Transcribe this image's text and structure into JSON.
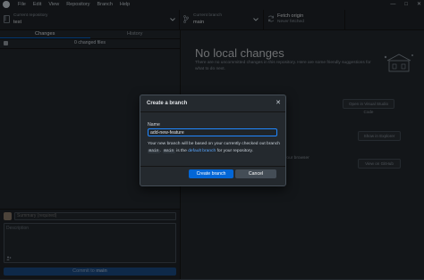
{
  "menu": [
    "File",
    "Edit",
    "View",
    "Repository",
    "Branch",
    "Help"
  ],
  "window_controls": [
    "—",
    "□",
    "✕"
  ],
  "toolbar": {
    "repo_caption": "Current repository",
    "repo_name": "test",
    "branch_caption": "Current branch",
    "branch_name": "main",
    "fetch_caption": "Fetch origin",
    "fetch_status": "Never fetched"
  },
  "tabs": [
    {
      "label": "Changes",
      "active": true
    },
    {
      "label": "History",
      "active": false
    }
  ],
  "changes": {
    "count_label": "0 changed files"
  },
  "commit": {
    "summary_placeholder": "Summary (required)",
    "description_placeholder": "Description",
    "button_prefix": "Commit to",
    "button_branch": "main"
  },
  "no_changes": {
    "title": "No local changes",
    "subtitle": "There are no uncommitted changes in this repository. Here are some friendly suggestions for what to do next.",
    "actions": [
      "Open in Visual Studio Code",
      "Show in Explorer",
      "View on GitHub"
    ],
    "hint": "your browser"
  },
  "dialog": {
    "title": "Create a branch",
    "name_label": "Name",
    "name_value": "add-new-feature",
    "note_prefix": "Your new branch will be based on your currently checked out branch",
    "note_branch_1": "main",
    "note_mid": ".",
    "note_branch_2": "main",
    "note_is": "is the",
    "note_link": "default branch",
    "note_suffix": "for your repository.",
    "create_label": "Create branch",
    "cancel_label": "Cancel"
  },
  "colors": {
    "accent": "#0366d6",
    "link": "#58a6ff",
    "background": "#24292e"
  }
}
